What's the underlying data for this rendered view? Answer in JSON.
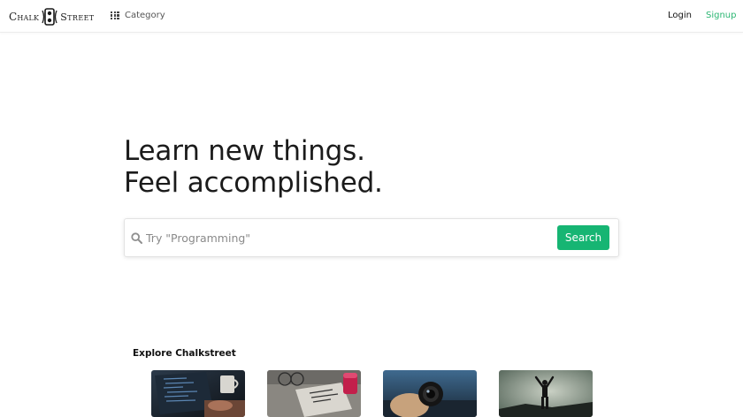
{
  "header": {
    "logo": {
      "word1": "Chalk",
      "word2": "Street"
    },
    "category_label": "Category",
    "login_label": "Login",
    "signup_label": "Signup"
  },
  "hero": {
    "line1": "Learn new things.",
    "line2": "Feel accomplished."
  },
  "search": {
    "placeholder": "Try \"Programming\"",
    "value": "",
    "button_label": "Search"
  },
  "explore": {
    "title": "Explore Chalkstreet",
    "tiles": [
      {
        "name": "coding-laptop",
        "icon": "laptop-image"
      },
      {
        "name": "business-book",
        "icon": "book-image"
      },
      {
        "name": "camera-lens",
        "icon": "lens-image"
      },
      {
        "name": "summit-silhouette",
        "icon": "person-summit-image"
      }
    ]
  },
  "colors": {
    "accent": "#16b573",
    "signup": "#2bb673",
    "text": "#1b1b1b"
  }
}
